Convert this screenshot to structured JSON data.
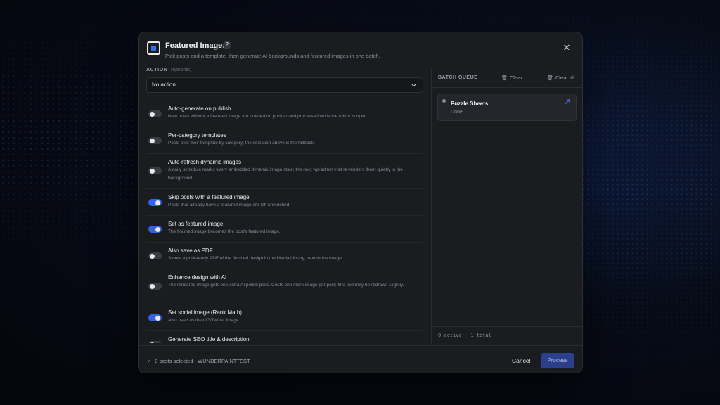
{
  "dialog": {
    "title": "Featured Images",
    "help_badge": "?",
    "subtitle": "Pick posts and a template, then generate AI backgrounds and featured images in one batch.",
    "close_glyph": "✕"
  },
  "action": {
    "label": "ACTION",
    "optional_label": "(optional)",
    "selected": "No action"
  },
  "toggles": [
    {
      "title": "Auto-generate on publish",
      "description": "New posts without a featured image are queued on publish and processed while the editor is open.",
      "on": false
    },
    {
      "title": "Per-category templates",
      "description": "Posts pick their template by category; the selection above is the fallback.",
      "on": false
    },
    {
      "title": "Auto-refresh dynamic images",
      "description": "A daily schedule marks every embedded dynamic image stale; the next wp-admin visit re-renders them quietly in the background.",
      "on": false
    },
    {
      "title": "Skip posts with a featured image",
      "description": "Posts that already have a featured image are left untouched.",
      "on": true
    },
    {
      "title": "Set as featured image",
      "description": "The finished image becomes the post's featured image.",
      "on": true
    },
    {
      "title": "Also save as PDF",
      "description": "Stores a print-ready PDF of the finished design in the Media Library, next to the image.",
      "on": false
    },
    {
      "title": "Enhance design with AI",
      "description": "The rendered image gets one extra AI polish pass. Costs one more image per post; fine text may be redrawn slightly.",
      "on": false
    },
    {
      "title": "Set social image (Rank Math)",
      "description": "Also used as the OG/Twitter image.",
      "on": true
    },
    {
      "title": "Generate SEO title & description",
      "description": "",
      "on": false
    }
  ],
  "queue": {
    "title": "BATCH QUEUE",
    "clear_label": "Clear",
    "clear_all_label": "Clear all",
    "items": [
      {
        "name": "Puzzle Sheets",
        "status": "Done"
      }
    ],
    "summary": "0 active · 1 total"
  },
  "footer": {
    "status": "0 posts selected · WUNDERPAINTTEST",
    "cancel_label": "Cancel",
    "process_label": "Process"
  },
  "colors": {
    "accent": "#3462e8",
    "process_button": "#2c3f8c",
    "background": "#1b1c20"
  }
}
